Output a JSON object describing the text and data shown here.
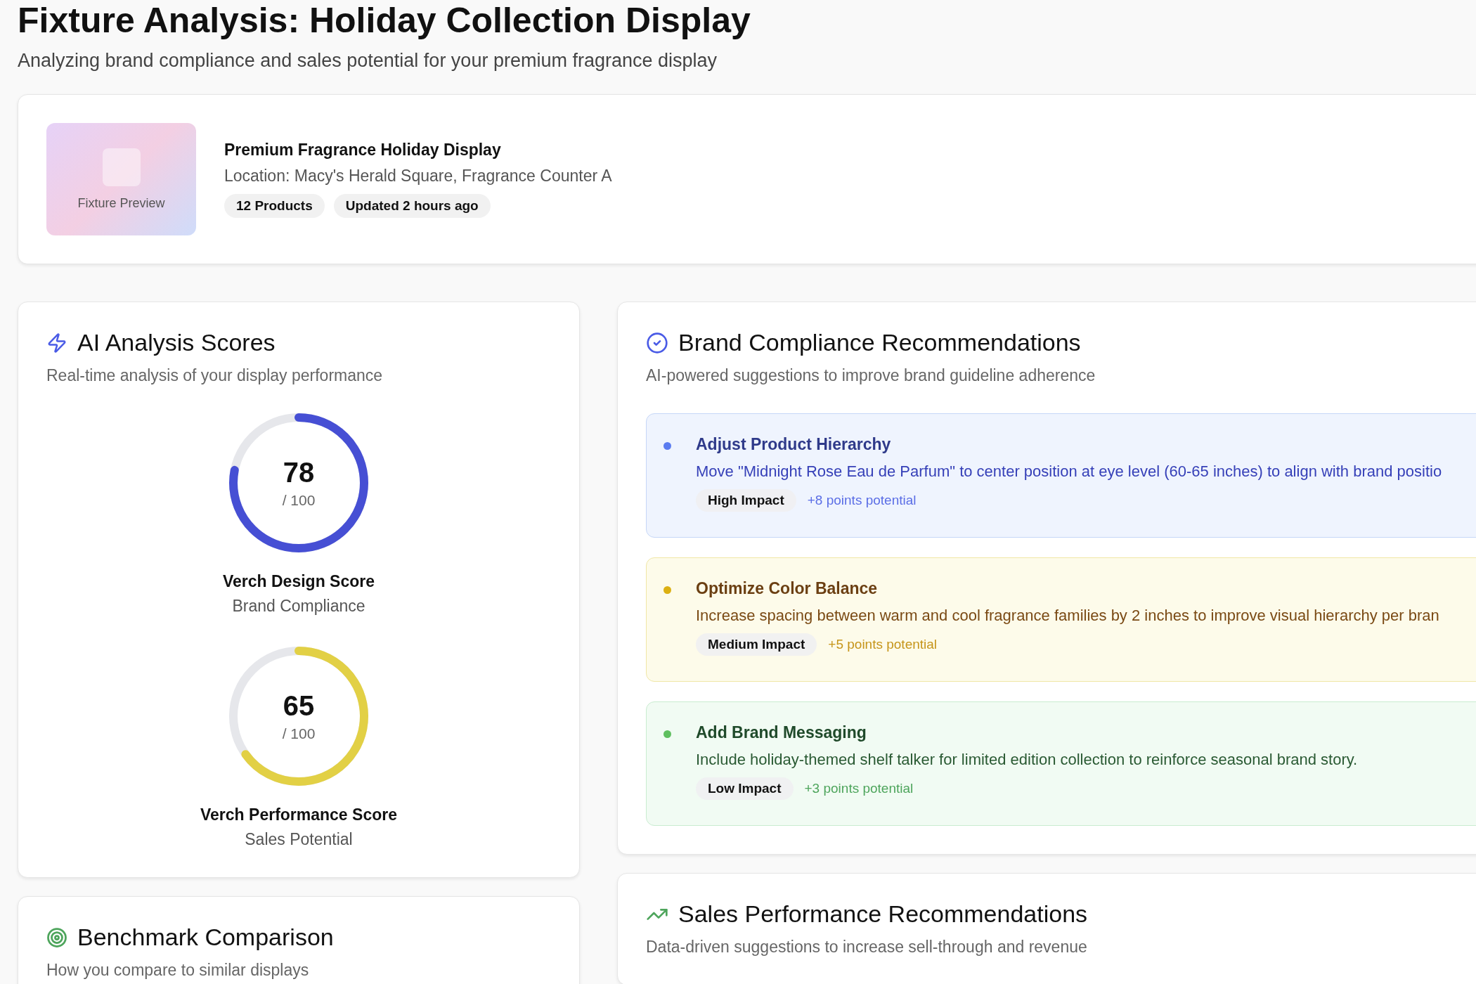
{
  "header": {
    "title": "Fixture Analysis: Holiday Collection Display",
    "subtitle": "Analyzing brand compliance and sales potential for your premium fragrance display"
  },
  "fixture": {
    "preview_label": "Fixture Preview",
    "name": "Premium Fragrance Holiday Display",
    "location": "Location: Macy's Herald Square, Fragrance Counter A",
    "badges": [
      "12 Products",
      "Updated 2 hours ago"
    ]
  },
  "scores": {
    "title": "AI Analysis Scores",
    "subtitle": "Real-time analysis of your display performance",
    "gauges": [
      {
        "value": "78",
        "max_label": "/ 100",
        "name": "Verch Design Score",
        "caption": "Brand Compliance",
        "level": 0.78,
        "color": "#464fd4"
      },
      {
        "value": "65",
        "max_label": "/ 100",
        "name": "Verch Performance Score",
        "caption": "Sales Potential",
        "level": 0.65,
        "color": "#e2d045"
      }
    ]
  },
  "benchmark": {
    "title": "Benchmark Comparison",
    "subtitle": "How you compare to similar displays"
  },
  "compliance": {
    "title": "Brand Compliance Recommendations",
    "subtitle": "AI-powered suggestions to improve brand guideline adherence",
    "recommendations": [
      {
        "kind": "high",
        "color": "#5b7cf0",
        "title": "Adjust Product Hierarchy",
        "description": "Move \"Midnight Rose Eau de Parfum\" to center position at eye level (60-65 inches) to align with brand positio",
        "impact": "High Impact",
        "points": "+8 points potential"
      },
      {
        "kind": "medium",
        "color": "#dcb012",
        "title": "Optimize Color Balance",
        "description": "Increase spacing between warm and cool fragrance families by 2 inches to improve visual hierarchy per bran",
        "impact": "Medium Impact",
        "points": "+5 points potential"
      },
      {
        "kind": "low",
        "color": "#5fbf5f",
        "title": "Add Brand Messaging",
        "description": "Include holiday-themed shelf talker for limited edition collection to reinforce seasonal brand story.",
        "impact": "Low Impact",
        "points": "+3 points potential"
      }
    ]
  },
  "sales": {
    "title": "Sales Performance Recommendations",
    "subtitle": "Data-driven suggestions to increase sell-through and revenue"
  }
}
